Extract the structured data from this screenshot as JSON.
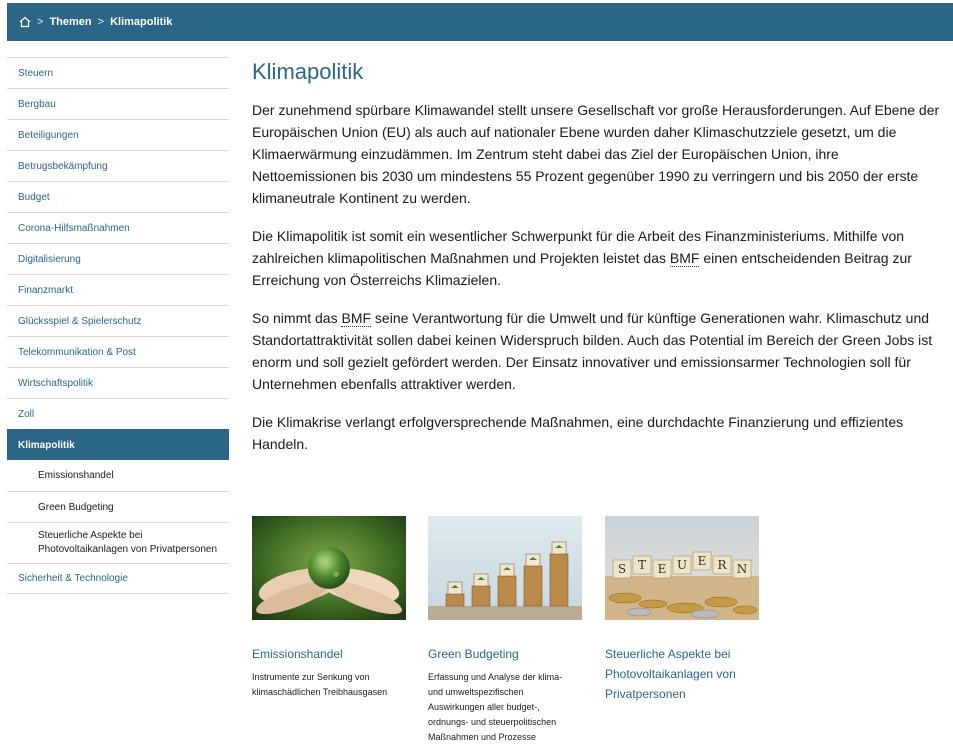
{
  "breadcrumb": {
    "home_icon": "home-icon",
    "separator": ">",
    "items": [
      "Themen",
      "Klimapolitik"
    ]
  },
  "sidebar": {
    "items": [
      {
        "label": "Steuern"
      },
      {
        "label": "Bergbau"
      },
      {
        "label": "Beteiligungen"
      },
      {
        "label": "Betrugsbekämpfung"
      },
      {
        "label": "Budget"
      },
      {
        "label": "Corona-Hilfsmaßnahmen"
      },
      {
        "label": "Digitalisierung"
      },
      {
        "label": "Finanzmarkt"
      },
      {
        "label": "Glücksspiel & Spielerschutz"
      },
      {
        "label": "Telekommunikation & Post"
      },
      {
        "label": "Wirtschaftspolitik"
      },
      {
        "label": "Zoll"
      },
      {
        "label": "Klimapolitik"
      },
      {
        "label": "Emissionshandel"
      },
      {
        "label": "Green Budgeting"
      },
      {
        "label": "Steuerliche Aspekte bei Photovoltaikanlagen von Privatpersonen"
      },
      {
        "label": "Sicherheit & Technologie"
      }
    ]
  },
  "main": {
    "title": "Klimapolitik",
    "p1": "Der zunehmend spürbare Klimawandel stellt unsere Gesellschaft vor große Herausforderungen. Auf Ebene der Europäischen Union (EU) als auch auf nationaler Ebene wurden daher Klimaschutzziele gesetzt, um die Klimaerwärmung einzudämmen. Im Zentrum steht dabei das Ziel der Europäischen Union, ihre Nettoemissionen bis 2030 um mindestens 55 Prozent gegenüber 1990 zu verringern und bis 2050 der erste klimaneutrale Kontinent zu werden.",
    "p2a": "Die Klimapolitik ist somit ein wesentlicher Schwerpunkt für die Arbeit des Finanzministeriums. Mithilfe von zahlreichen klimapolitischen Maßnahmen und Projekten leistet das ",
    "p2abbr": "BMF",
    "p2b": " einen entscheidenden Beitrag zur Erreichung von Österreichs Klimazielen.",
    "p3a": "So nimmt das ",
    "p3abbr": "BMF",
    "p3b": " seine Verantwortung für die Umwelt und für künftige Generationen wahr. Klimaschutz und Standortattraktivität sollen dabei keinen Widerspruch bilden. Auch das Potential im Bereich der Green Jobs ist enorm und soll gezielt gefördert werden. Der Einsatz innovativer und emissionsarmer Technologien soll für Unternehmen ebenfalls attraktiver werden.",
    "p4": "Die Klimakrise verlangt erfolgversprechende Maßnahmen, eine durchdachte Finanzierung und effizientes Handeln."
  },
  "cards": [
    {
      "title": "Emissionshandel",
      "desc": "Instrumente zur Senkung von klimaschädlichen Treibhausgasen"
    },
    {
      "title": "Green Budgeting",
      "desc": "Erfassung und Analyse der klima- und umweltspezifischen Auswirkungen aller budget-, ordnungs- und steuerpolitischen Maßnahmen und Prozesse"
    },
    {
      "title": "Steuerliche Aspekte bei Photovoltaikanlagen von Privatpersonen",
      "desc": ""
    }
  ],
  "tiles_text": [
    "S",
    "T",
    "E",
    "U",
    "E",
    "R",
    "N"
  ],
  "colors": {
    "brand": "#2b6689",
    "text": "#1a1a1a",
    "divider": "#d9d9d9"
  }
}
